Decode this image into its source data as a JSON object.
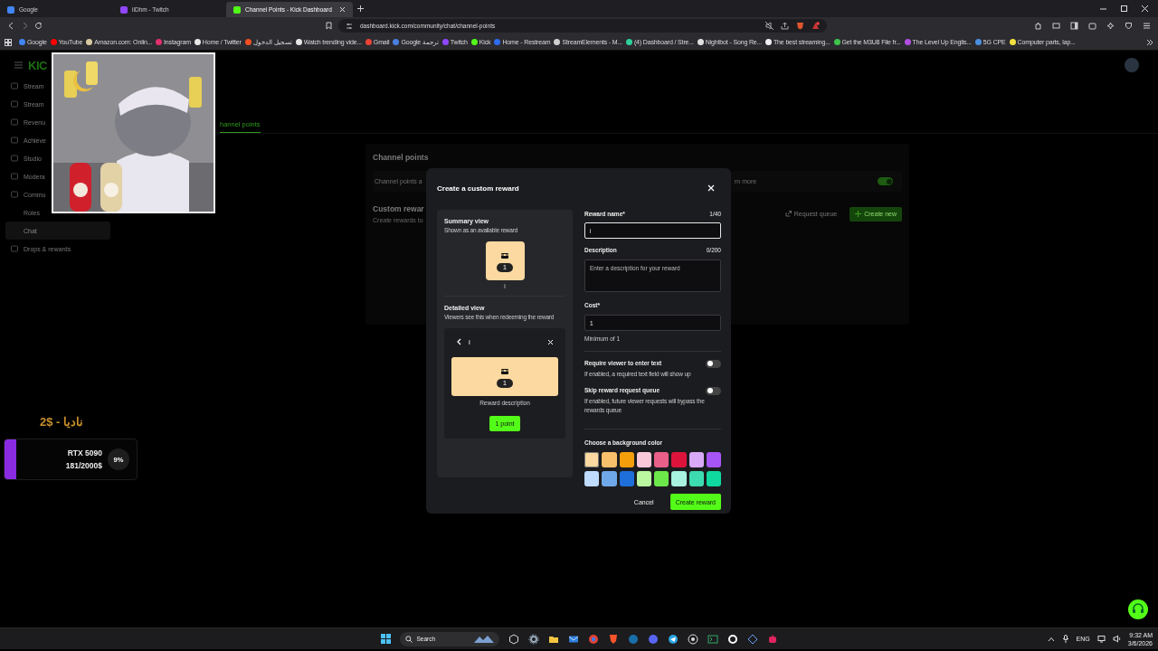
{
  "browser": {
    "tabs": [
      {
        "title": "Google",
        "selected": false,
        "color": "#4285f4"
      },
      {
        "title": "iiDhm - Twitch",
        "selected": false,
        "color": "#9146ff"
      },
      {
        "title": "Channel Points - Kick Dashboard",
        "selected": true,
        "color": "#53fc18"
      }
    ],
    "url": "dashboard.kick.com/community/chat/channel-points",
    "bookmarks": [
      {
        "label": "Google",
        "color": "#4285f4"
      },
      {
        "label": "YouTube",
        "color": "#ff0000"
      },
      {
        "label": "Amazon.com: Onlin...",
        "color": "#d8c9a0"
      },
      {
        "label": "Instagram",
        "color": "#e1306c"
      },
      {
        "label": "Home / Twitter",
        "color": "#e7e7e7"
      },
      {
        "label": "تسجيل الدخول",
        "color": "#f25022"
      },
      {
        "label": "Watch trending vide...",
        "color": "#e7e7e7"
      },
      {
        "label": "Gmail",
        "color": "#ea4335"
      },
      {
        "label": "Google ترجمة",
        "color": "#4a7fe0"
      },
      {
        "label": "Twitch",
        "color": "#9146ff"
      },
      {
        "label": "Kick",
        "color": "#53fc18"
      },
      {
        "label": "Home - Restream",
        "color": "#2f6bf0"
      },
      {
        "label": "StreamElements - M...",
        "color": "#d0d0d0"
      },
      {
        "label": "(4) Dashboard / Stre...",
        "color": "#2fd19a"
      },
      {
        "label": "Nightbot - Song Re...",
        "color": "#e0e0e0"
      },
      {
        "label": "The best streaming...",
        "color": "#f0f0f0"
      },
      {
        "label": "Get the M3U8 File fr...",
        "color": "#3fc34a"
      },
      {
        "label": "The Level Up Englis...",
        "color": "#b04fe0"
      },
      {
        "label": "5G CPE",
        "color": "#4a8fe0"
      },
      {
        "label": "Computer parts, lap...",
        "color": "#f0e040"
      }
    ]
  },
  "dashboard": {
    "logo": "KIC",
    "sidebar": [
      {
        "label": "Stream",
        "selected": false
      },
      {
        "label": "Stream",
        "selected": false
      },
      {
        "label": "Revenu",
        "selected": false
      },
      {
        "label": "Achieve",
        "selected": false
      },
      {
        "label": "Studio",
        "selected": false
      },
      {
        "label": "Modera",
        "selected": false
      },
      {
        "label": "Commu",
        "selected": false,
        "children": [
          {
            "label": "Roles",
            "selected": false
          },
          {
            "label": "Chat",
            "selected": true
          }
        ]
      },
      {
        "label": "Drops & rewards",
        "selected": false
      }
    ],
    "tab": {
      "label": "hannel points",
      "selected": true
    },
    "channel_points": {
      "title": "Channel points",
      "description": "Channel points a",
      "link": "rn more",
      "enabled": true
    },
    "custom_rewards": {
      "title": "Custom rewar",
      "subtitle": "Create rewards to",
      "buttons": [
        {
          "label": "Request queue",
          "kind": "secondary"
        },
        {
          "label": "Create new",
          "kind": "primary"
        }
      ]
    }
  },
  "goal_widget": {
    "donation": "2$ - ناديا",
    "title": "RTX 5090",
    "progress": "181/2000$",
    "percent": "9%",
    "level": 0.09
  },
  "modal": {
    "title": "Create a custom reward",
    "summary": {
      "title": "Summary view",
      "subtitle": "Shown as an available reward",
      "cost": "1",
      "name": "i"
    },
    "detailed": {
      "title": "Detailed view",
      "subtitle": "Viewers see this when redeeming the reward",
      "name": "i",
      "cost": "1",
      "description": "Reward description",
      "button": "1 point"
    },
    "fields": [
      {
        "kind": "input",
        "label": "Reward name*",
        "counter": "1/40",
        "value": "i",
        "focused": true
      },
      {
        "kind": "textarea",
        "label": "Description",
        "counter": "0/200",
        "placeholder": "Enter a description for your reward",
        "focused": false
      },
      {
        "kind": "input",
        "label": "Cost*",
        "value": "1",
        "hint": "Minimum of 1",
        "focused": false
      }
    ],
    "toggles": [
      {
        "label": "Require viewer to enter text",
        "description": "If enabled, a required text field will show up",
        "on": false
      },
      {
        "label": "Skip reward request queue",
        "description": "If enabled, future viewer requests will bypass the rewards queue",
        "on": false
      }
    ],
    "color_label": "Choose a background color",
    "colors": [
      {
        "color": "#fcd9a0",
        "selected": true
      },
      {
        "color": "#f8c06a",
        "selected": false
      },
      {
        "color": "#f59e0b",
        "selected": false
      },
      {
        "color": "#f9c9d9",
        "selected": false
      },
      {
        "color": "#e8608a",
        "selected": false
      },
      {
        "color": "#dc143c",
        "selected": false
      },
      {
        "color": "#d8a9f6",
        "selected": false
      },
      {
        "color": "#a855f7",
        "selected": false
      },
      {
        "color": "#bfdbfe",
        "selected": false
      },
      {
        "color": "#6fa8e8",
        "selected": false
      },
      {
        "color": "#1e6fd9",
        "selected": false
      },
      {
        "color": "#bbf7a0",
        "selected": false
      },
      {
        "color": "#6de84a",
        "selected": false
      },
      {
        "color": "#a7f3e0",
        "selected": false
      },
      {
        "color": "#3ddbb0",
        "selected": false
      },
      {
        "color": "#10d9a0",
        "selected": false
      }
    ],
    "buttons": [
      {
        "label": "Cancel",
        "kind": "secondary"
      },
      {
        "label": "Create reward",
        "kind": "primary"
      }
    ]
  },
  "taskbar": {
    "search": "Search",
    "language": "ENG",
    "time": "9:32 AM",
    "date": "3/6/2026"
  }
}
